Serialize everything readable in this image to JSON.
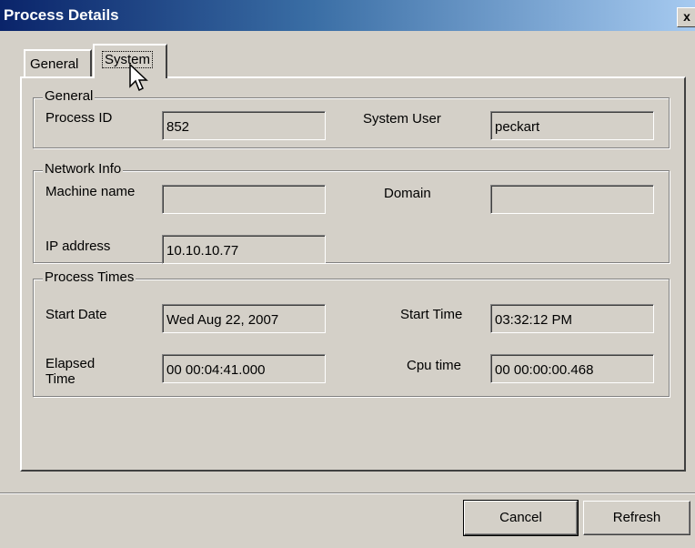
{
  "window": {
    "title": "Process Details",
    "close_label": "x"
  },
  "tabs": [
    {
      "label": "General",
      "selected": false
    },
    {
      "label": "System",
      "selected": true
    }
  ],
  "general_group": {
    "legend": "General",
    "process_id_label": "Process ID",
    "process_id_value": "852",
    "system_user_label": "System User",
    "system_user_value": "peckart"
  },
  "network_group": {
    "legend": "Network Info",
    "machine_name_label": "Machine name",
    "machine_name_value": "",
    "domain_label": "Domain",
    "domain_value": "",
    "ip_address_label": "IP address",
    "ip_address_value": "10.10.10.77"
  },
  "times_group": {
    "legend": "Process Times",
    "start_date_label": "Start Date",
    "start_date_value": "Wed  Aug 22, 2007",
    "start_time_label": "Start Time",
    "start_time_value": "03:32:12 PM",
    "elapsed_label_line1": "Elapsed",
    "elapsed_label_line2": "Time",
    "elapsed_value": "00  00:04:41.000",
    "cpu_time_label": "Cpu time",
    "cpu_time_value": "00  00:00:00.468"
  },
  "buttons": {
    "cancel_label": "Cancel",
    "refresh_label": "Refresh"
  },
  "icons": {
    "cursor": "mouse-pointer-icon"
  },
  "colors": {
    "title_bar_start": "#0a246a",
    "title_bar_end": "#a6caf0",
    "window_face": "#d4d0c8"
  }
}
